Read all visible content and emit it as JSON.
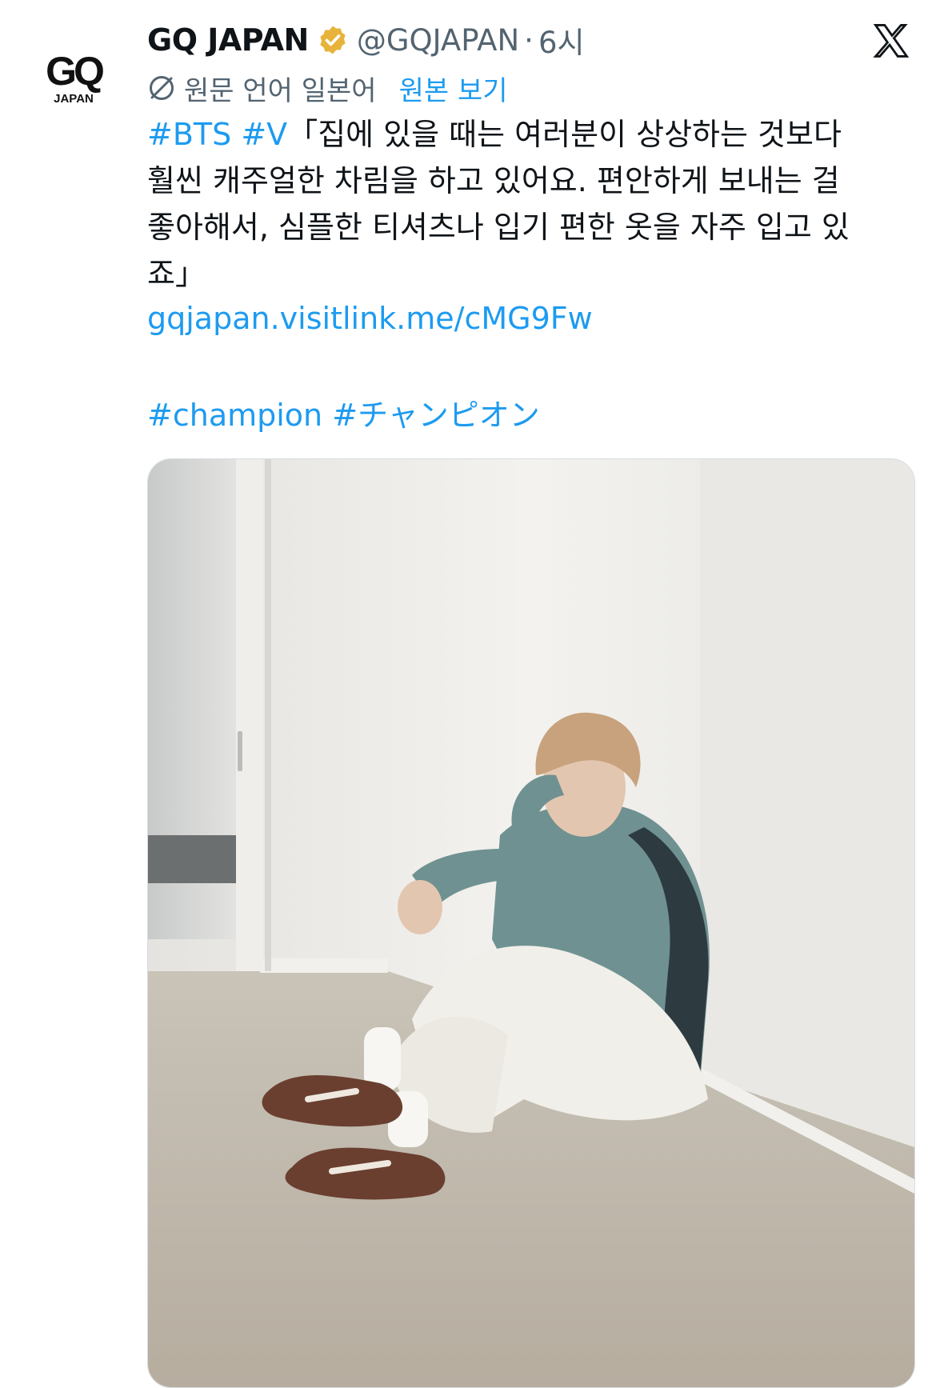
{
  "tweet": {
    "author": {
      "avatar_logo": "GQ",
      "avatar_logo_sub": "JAPAN",
      "display_name": "GQ JAPAN",
      "verified_icon": "verified-badge-icon",
      "handle": "@GQJAPAN",
      "separator": "·",
      "time": "6시"
    },
    "platform_icon": "x-logo-icon",
    "translation": {
      "icon": "translate-icon",
      "label": "원문 언어 일본어",
      "show_original": "원본 보기"
    },
    "text": {
      "hashtag_bts": "#BTS",
      "hashtag_v": "#V",
      "line1_rest": "「집에 있을 때는 여러분이 상상하는 것보다",
      "line2": "훨씬 캐주얼한 차림을 하고 있어요. 편안하게 보내는 걸",
      "line3": "좋아해서, 심플한 티셔츠나 입기 편한 옷을 자주 입고 있",
      "line4": "죠」",
      "link": "gqjapan.visitlink.me/cMG9Fw",
      "hashtag_champion": "#champion",
      "hashtag_champion_jp": "#チャンピオン"
    },
    "media": {
      "type": "photo"
    }
  },
  "colors": {
    "link_blue": "#1d9bf0",
    "text_primary": "#0f1419",
    "text_secondary": "#536471",
    "verified_gold": "#e8b33a"
  }
}
